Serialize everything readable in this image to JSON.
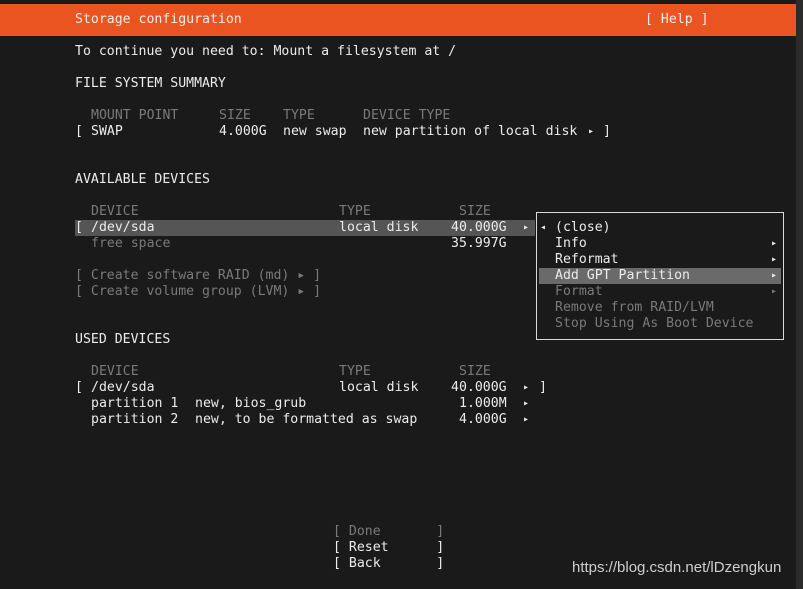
{
  "header": {
    "title": "Storage configuration",
    "help_label": "[ Help ]",
    "bar_color": "#e95420"
  },
  "instruction": "To continue you need to: Mount a filesystem at /",
  "fs_summary": {
    "heading": "FILE SYSTEM SUMMARY",
    "columns": [
      "MOUNT POINT",
      "SIZE",
      "TYPE",
      "DEVICE TYPE"
    ],
    "rows": [
      {
        "bracket": "[",
        "mount": "SWAP",
        "size": "4.000G",
        "type": "new swap",
        "device_type": "new partition of local disk",
        "arrow": "▸",
        "end": "]"
      }
    ]
  },
  "available": {
    "heading": "AVAILABLE DEVICES",
    "columns": [
      "DEVICE",
      "TYPE",
      "SIZE"
    ],
    "device": {
      "bracket": "[",
      "name": "/dev/sda",
      "type": "local disk",
      "size": "40.000G",
      "arrow": "▸"
    },
    "free_space": {
      "label": "free space",
      "size": "35.997G"
    },
    "create_raid": "[ Create software RAID (md) ▸ ]",
    "create_lvm": "[ Create volume group (LVM) ▸ ]"
  },
  "used": {
    "heading": "USED DEVICES",
    "columns": [
      "DEVICE",
      "TYPE",
      "SIZE"
    ],
    "device": {
      "bracket": "[",
      "name": "/dev/sda",
      "type": "local disk",
      "size": "40.000G",
      "arrow": "▸",
      "end": "]"
    },
    "partitions": [
      {
        "label": "partition 1",
        "desc": "new, bios_grub",
        "size": "1.000M",
        "arrow": "▸"
      },
      {
        "label": "partition 2",
        "desc": "new, to be formatted as swap",
        "size": "4.000G",
        "arrow": "▸"
      }
    ]
  },
  "context_menu": {
    "close_arrow": "◂",
    "items": [
      {
        "label": "(close)",
        "arrow": ""
      },
      {
        "label": "Info",
        "arrow": "▸"
      },
      {
        "label": "Reformat",
        "arrow": "▸"
      },
      {
        "label": "Add GPT Partition",
        "arrow": "▸"
      },
      {
        "label": "Format",
        "arrow": "▸"
      },
      {
        "label": "Remove from RAID/LVM",
        "arrow": ""
      },
      {
        "label": "Stop Using As Boot Device",
        "arrow": ""
      }
    ],
    "selected": "Add GPT Partition"
  },
  "buttons": {
    "done": "[ Done       ]",
    "reset": "[ Reset      ]",
    "back": "[ Back       ]"
  },
  "watermark": "https://blog.csdn.net/lDzengkun"
}
